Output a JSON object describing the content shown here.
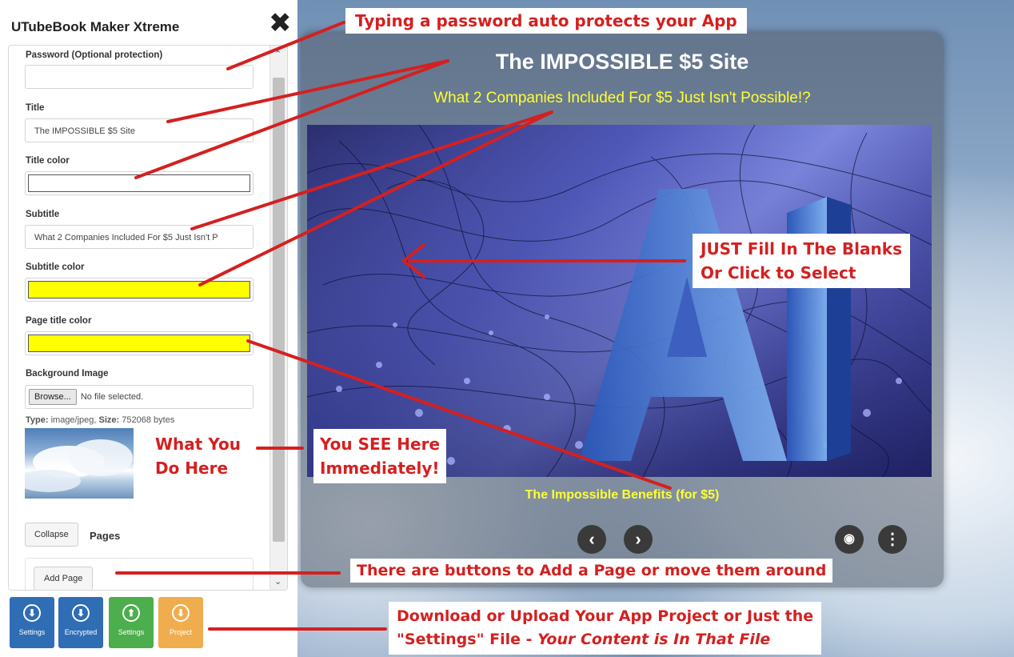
{
  "panel": {
    "app_title": "UTubeBook Maker Xtreme",
    "close_glyph": "✖",
    "fields": {
      "password_label": "Password (Optional protection)",
      "password_value": "",
      "title_label": "Title",
      "title_value": "The IMPOSSIBLE $5 Site",
      "title_color_label": "Title color",
      "title_color_value": "#ffffff",
      "subtitle_label": "Subtitle",
      "subtitle_value": "What 2 Companies Included For $5 Just Isn't P",
      "subtitle_color_label": "Subtitle color",
      "subtitle_color_value": "#ffff00",
      "page_title_color_label": "Page title color",
      "page_title_color_value": "#ffff00",
      "bg_image_label": "Background Image",
      "browse_label": "Browse...",
      "no_file_text": "No file selected.",
      "file_type_label": "Type:",
      "file_type_value": "image/jpeg,",
      "file_size_label": "Size:",
      "file_size_value": "752068 bytes"
    },
    "collapse_label": "Collapse",
    "pages_label": "Pages",
    "add_page_label": "Add Page"
  },
  "download_buttons": [
    {
      "label": "Settings",
      "icon": "download-icon",
      "color": "#2f6db5",
      "glyph": "⬇"
    },
    {
      "label": "Encrypted",
      "icon": "download-icon",
      "color": "#2f6db5",
      "glyph": "⬇"
    },
    {
      "label": "Settings",
      "icon": "upload-icon",
      "color": "#4cae4c",
      "glyph": "⬆"
    },
    {
      "label": "Project",
      "icon": "upload-icon",
      "color": "#f0ad4e",
      "glyph": "⬇"
    }
  ],
  "preview": {
    "site_title": "The IMPOSSIBLE $5 Site",
    "site_subtitle": "What 2 Companies Included For $5 Just Isn't Possible!?",
    "page_heading": "The Impossible Benefits (for $5)",
    "hero_text": "AI",
    "prev_glyph": "‹",
    "next_glyph": "›",
    "view_glyph": "◉",
    "menu_glyph": "⋮"
  },
  "annotations": {
    "password": "Typing a password auto protects your App",
    "fill_line1": "JUST Fill In The Blanks",
    "fill_line2": "Or Click to Select",
    "do_line1": "What You",
    "do_line2": "Do Here",
    "see_line1": "You SEE Here",
    "see_line2": "Immediately!",
    "buttons": "There are buttons to Add a Page or move them around",
    "download_line1": "Download or Upload Your App Project or Just the",
    "download_line2a": "\"Settings\" File - ",
    "download_line2b": "Your Content is In That File"
  },
  "colors": {
    "annotation_red": "#d42020",
    "subtitle_yellow": "#ffff33"
  }
}
